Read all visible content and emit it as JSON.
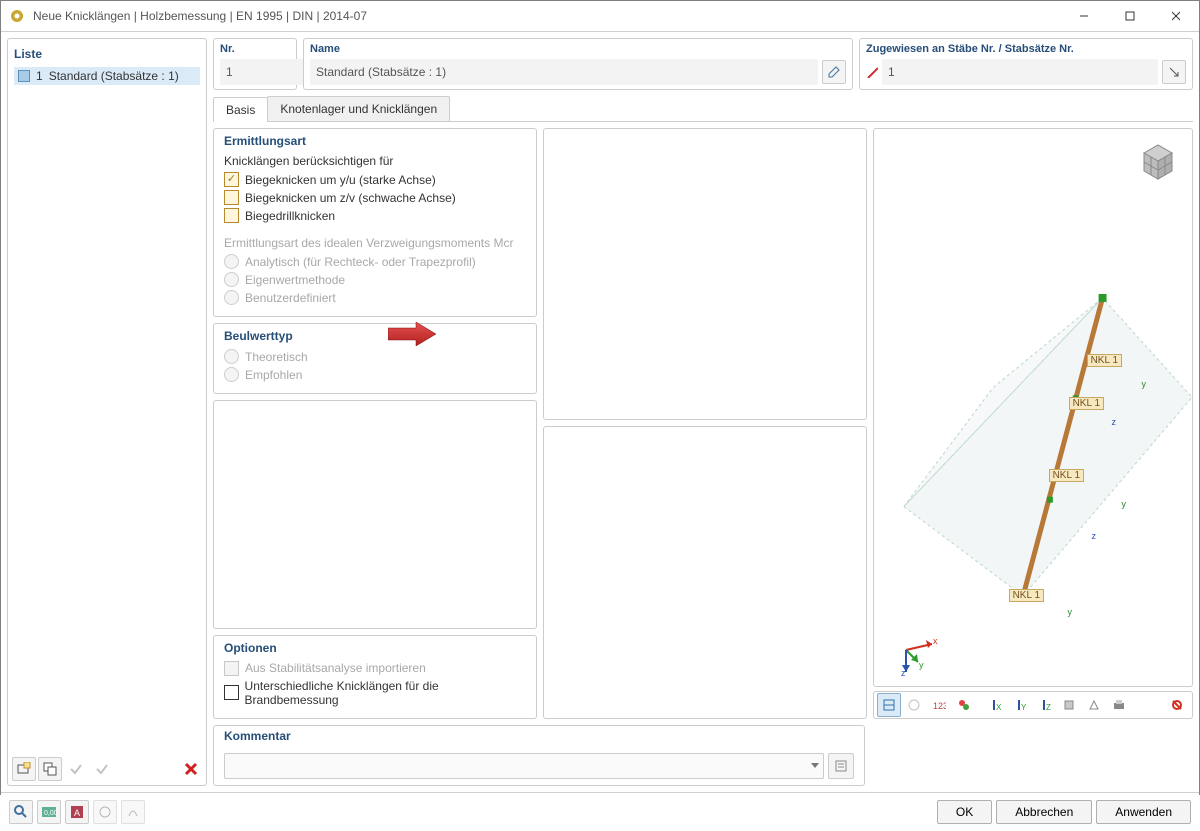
{
  "titlebar": {
    "title": "Neue Knicklängen | Holzbemessung | EN 1995 | DIN | 2014-07"
  },
  "left": {
    "liste_label": "Liste",
    "item_number": "1",
    "item_text": "Standard (Stabsätze : 1)"
  },
  "top": {
    "nr": {
      "label": "Nr.",
      "value": "1"
    },
    "name": {
      "label": "Name",
      "value": "Standard (Stabsätze : 1)"
    },
    "assigned": {
      "label": "Zugewiesen an Stäbe Nr. / Stabsätze Nr.",
      "value": "1"
    }
  },
  "tabs": {
    "basis": "Basis",
    "knoten": "Knotenlager und Knicklängen"
  },
  "ermittlungsart": {
    "title": "Ermittlungsart",
    "sub_knick": "Knicklängen berücksichtigen für",
    "chk_yu": "Biegeknicken um y/u (starke Achse)",
    "chk_zv": "Biegeknicken um z/v (schwache Achse)",
    "chk_drill": "Biegedrillknicken",
    "sub_mcr": "Ermittlungsart des idealen Verzweigungsmoments Mcr",
    "opt_analytisch": "Analytisch (für Rechteck- oder Trapezprofil)",
    "opt_eigen": "Eigenwertmethode",
    "opt_benutzer": "Benutzerdefiniert"
  },
  "beulwert": {
    "title": "Beulwerttyp",
    "opt_theo": "Theoretisch",
    "opt_empf": "Empfohlen"
  },
  "optionen": {
    "title": "Optionen",
    "chk_stab": "Aus Stabilitätsanalyse importieren",
    "chk_brand": "Unterschiedliche Knicklängen für die Brandbemessung"
  },
  "kommentar": {
    "title": "Kommentar"
  },
  "viewer": {
    "nkl": "NKL 1",
    "y": "y",
    "z": "z",
    "x": "x"
  },
  "buttons": {
    "ok": "OK",
    "cancel": "Abbrechen",
    "apply": "Anwenden"
  }
}
